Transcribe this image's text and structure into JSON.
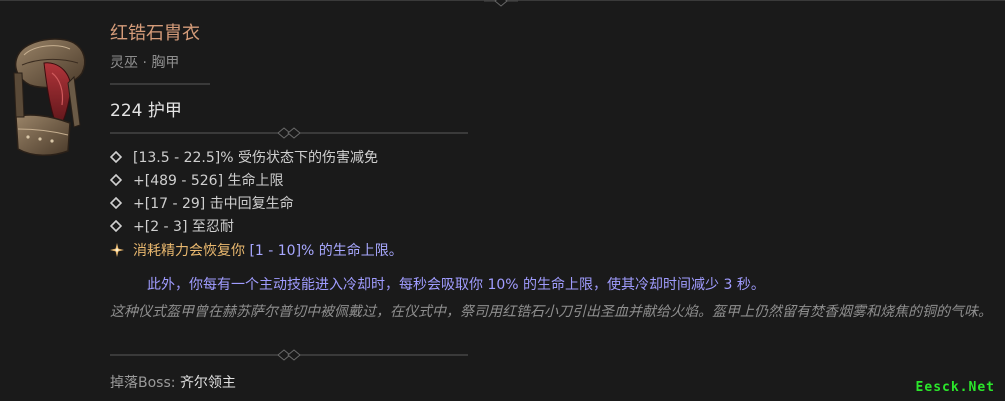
{
  "item": {
    "name": "红锆石胄衣",
    "type": "灵巫 · 胸甲",
    "armor": "224 护甲"
  },
  "affixes": [
    {
      "text": "[13.5 - 22.5]% 受伤状态下的伤害减免",
      "icon": "diamond-bullet-icon"
    },
    {
      "text": "+[489 - 526] 生命上限",
      "icon": "diamond-bullet-icon"
    },
    {
      "text": "+[17 - 29] 击中回复生命",
      "icon": "diamond-bullet-icon"
    },
    {
      "text": "+[2 - 3] 至忍耐",
      "icon": "diamond-bullet-icon"
    }
  ],
  "aspect": {
    "icon": "legendary-star-icon",
    "text_main": "消耗精力会恢复你 ",
    "text_range": "[1 - 10]% 的生命上限。",
    "detail": "此外，你每有一个主动技能进入冷却时，每秒会吸取你 10% 的生命上限，使其冷却时间减少 3 秒。"
  },
  "flavor": "这种仪式盔甲曾在赫苏萨尔普切中被佩戴过，在仪式中，祭司用红锆石小刀引出圣血并献给火焰。盔甲上仍然留有焚香烟雾和烧焦的铜的气味。",
  "drop": {
    "label": "掉落Boss: ",
    "value": "齐尔领主"
  },
  "watermark": "Eesck.Net",
  "colors": {
    "item_name": "#d49b79",
    "aspect": "#e9b86f",
    "aspect_range": "#a8a8ff",
    "aspect_detail": "#a09cff",
    "watermark": "#2be62b"
  }
}
